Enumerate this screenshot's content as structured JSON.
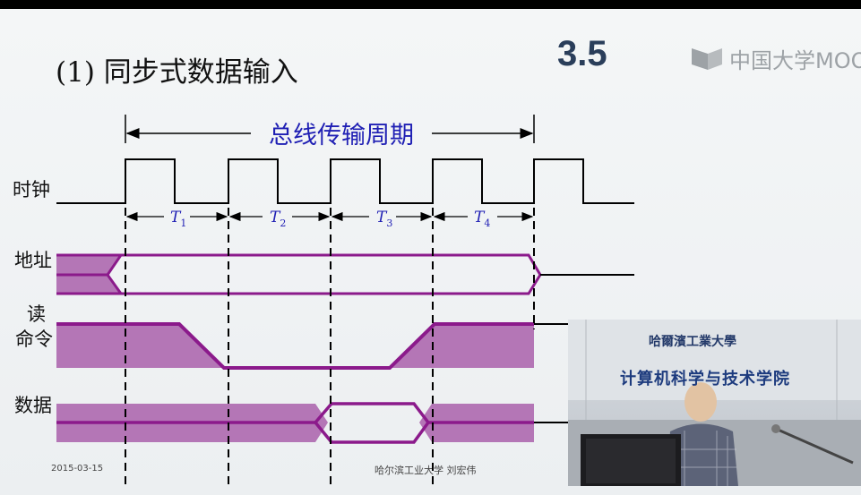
{
  "slide": {
    "title": "(1) 同步式数据输入",
    "section_number": "3.5",
    "watermark": "中国大学MOOC",
    "footer_date": "2015-03-15",
    "footer_credit": "哈尔滨工业大学  刘宏伟"
  },
  "diagram": {
    "bus_cycle_label": "总线传输周期",
    "signals": {
      "clock": "时钟",
      "address": "地址",
      "read_cmd_line1": "读",
      "read_cmd_line2": "命令",
      "data": "数据"
    },
    "periods": [
      {
        "label": "T",
        "sub": "1"
      },
      {
        "label": "T",
        "sub": "2"
      },
      {
        "label": "T",
        "sub": "3"
      },
      {
        "label": "T",
        "sub": "4"
      }
    ]
  },
  "video": {
    "banner_top": "哈爾濱工業大學",
    "banner_main": "计算机科学与技术学院"
  },
  "colors": {
    "signal_purple": "#8b1a8b",
    "signal_fill": "#b476b6",
    "cycle_label_blue": "#1f1fb4",
    "section_number": "#2a3e5a"
  }
}
